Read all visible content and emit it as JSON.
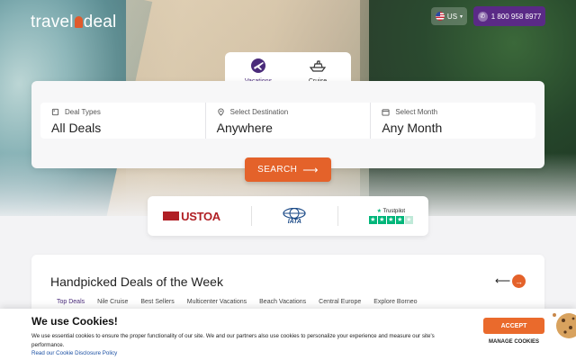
{
  "header": {
    "logo_left": "travel",
    "logo_right": "deal",
    "lang_label": "US",
    "phone": "1 800 958 8977"
  },
  "tabs": [
    {
      "label": "Vacations",
      "icon": "globe-plane-icon"
    },
    {
      "label": "Cruise",
      "icon": "ship-icon"
    }
  ],
  "search": {
    "fields": [
      {
        "label": "Deal Types",
        "value": "All Deals",
        "icon": "tag-icon"
      },
      {
        "label": "Select Destination",
        "value": "Anywhere",
        "icon": "location-pin-icon"
      },
      {
        "label": "Select Month",
        "value": "Any Month",
        "icon": "calendar-icon"
      }
    ],
    "button_label": "SEARCH"
  },
  "partners": {
    "ustoa": "USTOA",
    "iata": "IATA",
    "trustpilot": "Trustpilot"
  },
  "deals": {
    "title": "Handpicked Deals of the Week",
    "tabs": [
      "Top Deals",
      "Nile Cruise",
      "Best Sellers",
      "Multicenter Vacations",
      "Beach Vacations",
      "Central Europe",
      "Explore Borneo"
    ]
  },
  "cookie": {
    "title": "We use Cookies!",
    "text": "We use essential cookies to ensure the proper functionality of our site. We and our partners also use cookies to personalize your experience and measure our site's performance.",
    "link": "Read our Cookie Disclosure Policy",
    "accept": "ACCEPT",
    "manage": "MANAGE COOKIES"
  },
  "colors": {
    "accent_orange": "#e4622a",
    "brand_purple": "#5a2a86"
  }
}
